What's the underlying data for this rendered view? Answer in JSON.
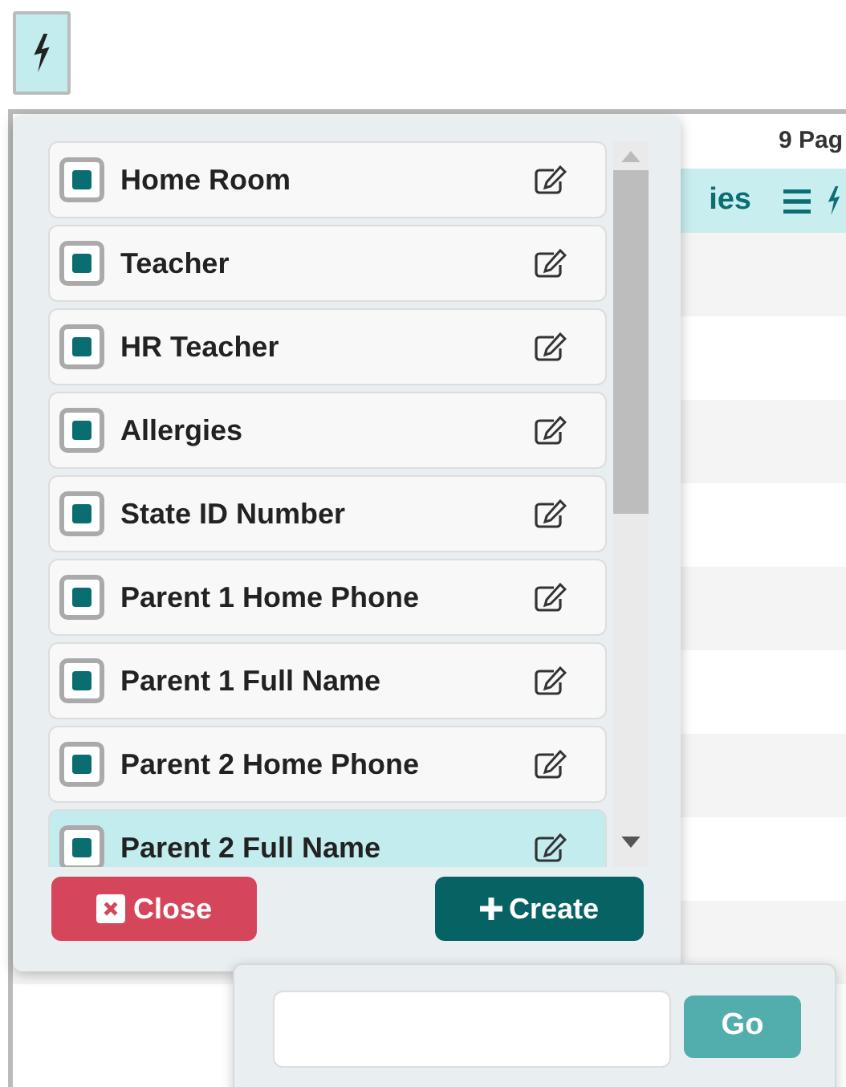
{
  "page": {
    "page_count": "9 Pag",
    "header_text": "ies"
  },
  "field_picker": {
    "items": [
      {
        "label": "Home Room",
        "checked": true,
        "selected": false
      },
      {
        "label": "Teacher",
        "checked": true,
        "selected": false
      },
      {
        "label": "HR Teacher",
        "checked": true,
        "selected": false
      },
      {
        "label": "Allergies",
        "checked": true,
        "selected": false
      },
      {
        "label": "State ID Number",
        "checked": true,
        "selected": false
      },
      {
        "label": "Parent 1 Home Phone",
        "checked": true,
        "selected": false
      },
      {
        "label": "Parent 1 Full Name",
        "checked": true,
        "selected": false
      },
      {
        "label": "Parent 2 Home Phone",
        "checked": true,
        "selected": false
      },
      {
        "label": "Parent 2 Full Name",
        "checked": true,
        "selected": true
      }
    ],
    "close_button": "Close",
    "create_button": "Create"
  },
  "create_popover": {
    "go_button": "Go"
  }
}
